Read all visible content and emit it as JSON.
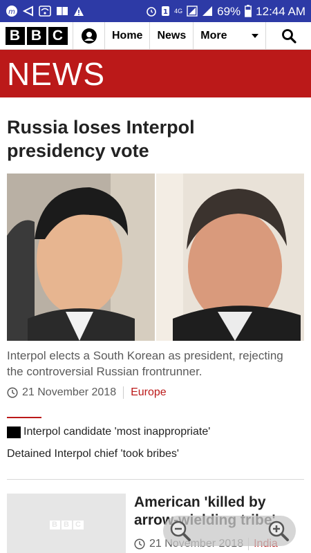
{
  "status_bar": {
    "battery": "69%",
    "time": "12:44 AM",
    "network": "4G"
  },
  "header": {
    "logo_letters": [
      "B",
      "B",
      "C"
    ],
    "nav": {
      "home": "Home",
      "news": "News",
      "more": "More"
    }
  },
  "banner": {
    "title": "NEWS"
  },
  "article": {
    "headline": "Russia loses Interpol presidency vote",
    "summary": "Interpol elects a South Korean as president, rejecting the controversial Russian frontrunner.",
    "date": "21 November 2018",
    "section": "Europe",
    "related": [
      "Interpol candidate 'most inappropriate'",
      "Detained Interpol chief 'took bribes'"
    ]
  },
  "next_card": {
    "title": "American 'killed by arrow-wielding tribe'",
    "date": "21 November 2018",
    "section": "India",
    "thumb_letters": [
      "B",
      "B",
      "C"
    ]
  },
  "colors": {
    "status_bar": "#2d3aa6",
    "bbc_red": "#bb1919"
  }
}
